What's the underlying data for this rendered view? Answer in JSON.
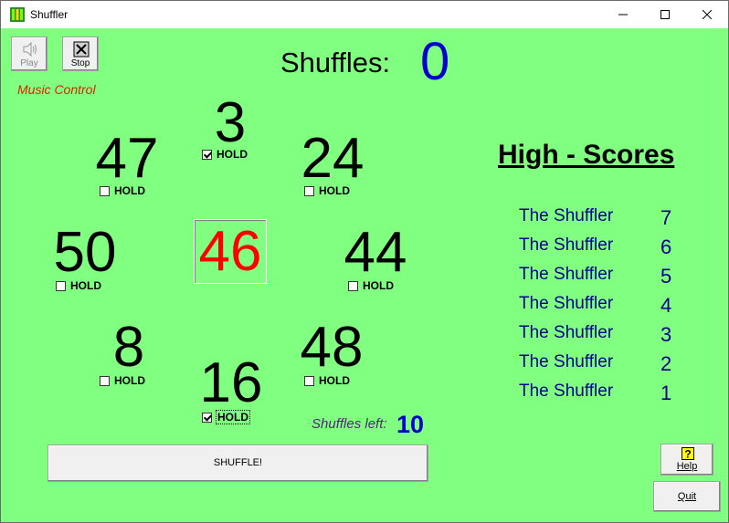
{
  "window": {
    "title": "Shuffler",
    "app_icon": "green-cards-icon"
  },
  "controls": {
    "play_label": "Play",
    "stop_label": "Stop",
    "music_label": "Music Control",
    "play_icon": "speaker-icon",
    "stop_icon": "stop-x-icon"
  },
  "shuffles": {
    "label": "Shuffles:",
    "count": "0"
  },
  "numbers": {
    "top": {
      "value": "3",
      "hold": "HOLD",
      "checked": true
    },
    "upper_left": {
      "value": "47",
      "hold": "HOLD",
      "checked": false
    },
    "upper_right": {
      "value": "24",
      "hold": "HOLD",
      "checked": false
    },
    "mid_left": {
      "value": "50",
      "hold": "HOLD",
      "checked": false
    },
    "center": {
      "value": "46"
    },
    "mid_right": {
      "value": "44",
      "hold": "HOLD",
      "checked": false
    },
    "lower_left": {
      "value": "8",
      "hold": "HOLD",
      "checked": false
    },
    "lower_right": {
      "value": "48",
      "hold": "HOLD",
      "checked": false
    },
    "bottom": {
      "value": "16",
      "hold": "HOLD",
      "checked": true
    }
  },
  "high_scores": {
    "title": "High - Scores",
    "entries": [
      {
        "name": "The Shuffler",
        "score": "7"
      },
      {
        "name": "The Shuffler",
        "score": "6"
      },
      {
        "name": "The Shuffler",
        "score": "5"
      },
      {
        "name": "The Shuffler",
        "score": "4"
      },
      {
        "name": "The Shuffler",
        "score": "3"
      },
      {
        "name": "The Shuffler",
        "score": "2"
      },
      {
        "name": "The Shuffler",
        "score": "1"
      }
    ]
  },
  "shuffles_left": {
    "label": "Shuffles left:",
    "count": "10"
  },
  "buttons": {
    "shuffle": "SHUFFLE!",
    "help": "Help",
    "quit": "Quit",
    "help_icon": "question-icon"
  },
  "colors": {
    "background": "#80ff80",
    "center_number": "#ff0000",
    "shuffle_count": "#0000cc",
    "music_label": "#e02000",
    "scores": "#00008b"
  }
}
